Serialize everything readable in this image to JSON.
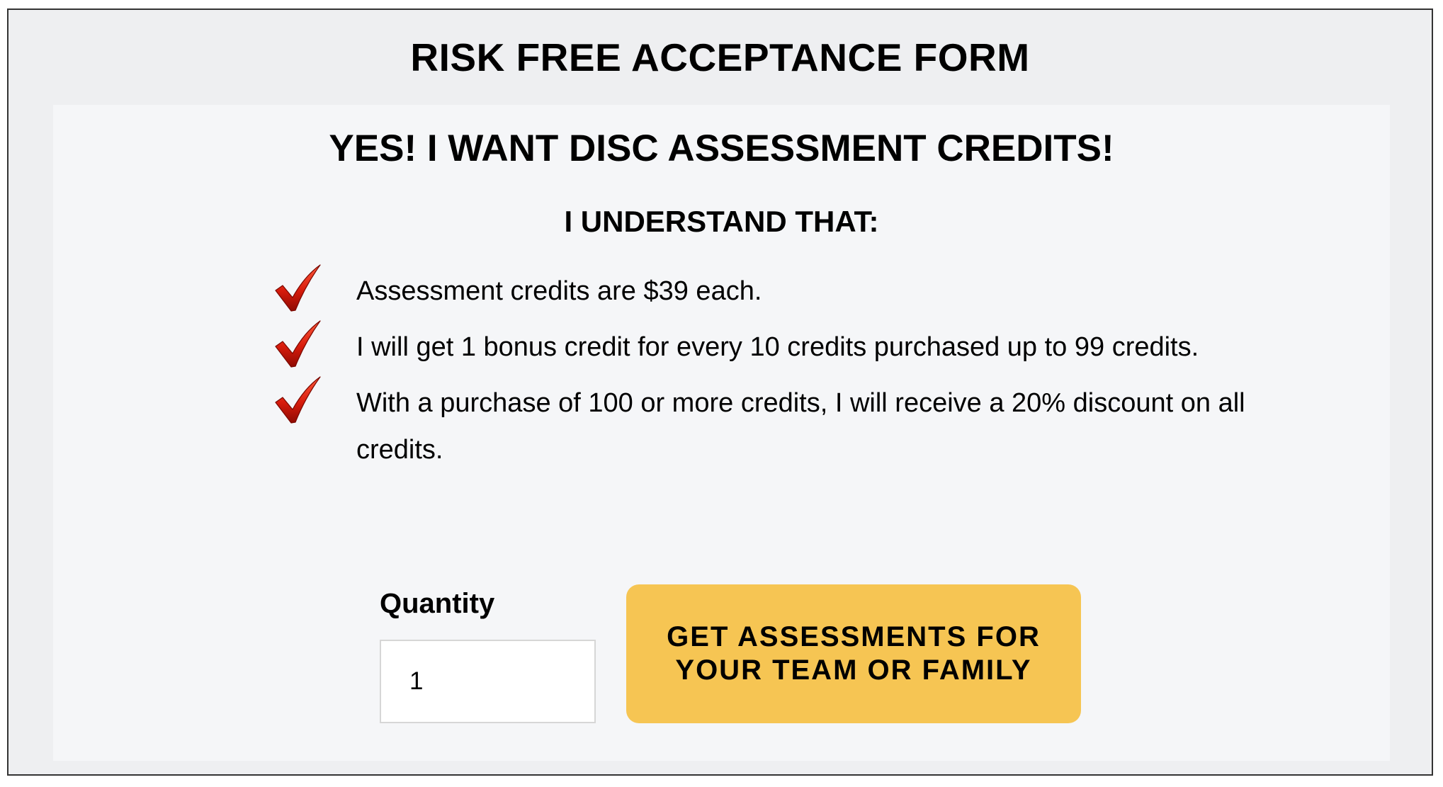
{
  "form": {
    "title": "RISK FREE ACCEPTANCE FORM",
    "headline": "YES! I WANT DISC ASSESSMENT CREDITS!",
    "subhead": "I UNDERSTAND THAT:",
    "benefits": [
      {
        "icon": "red-checkmark-icon",
        "text": "Assessment credits are $39 each."
      },
      {
        "icon": "red-checkmark-icon",
        "text": "I will get 1 bonus credit for every 10 credits purchased up to 99 credits."
      },
      {
        "icon": "red-checkmark-icon",
        "text": "With a purchase of 100 or more credits, I will receive a 20% discount on all credits."
      }
    ],
    "quantity": {
      "label": "Quantity",
      "value": "1"
    },
    "cta_label": "GET ASSESSMENTS FOR YOUR TEAM OR FAMILY"
  },
  "colors": {
    "frame_bg": "#eeeff1",
    "panel_bg": "#f5f6f8",
    "button_bg": "#f6c553",
    "check": "#d81c0c",
    "border": "#333333"
  }
}
